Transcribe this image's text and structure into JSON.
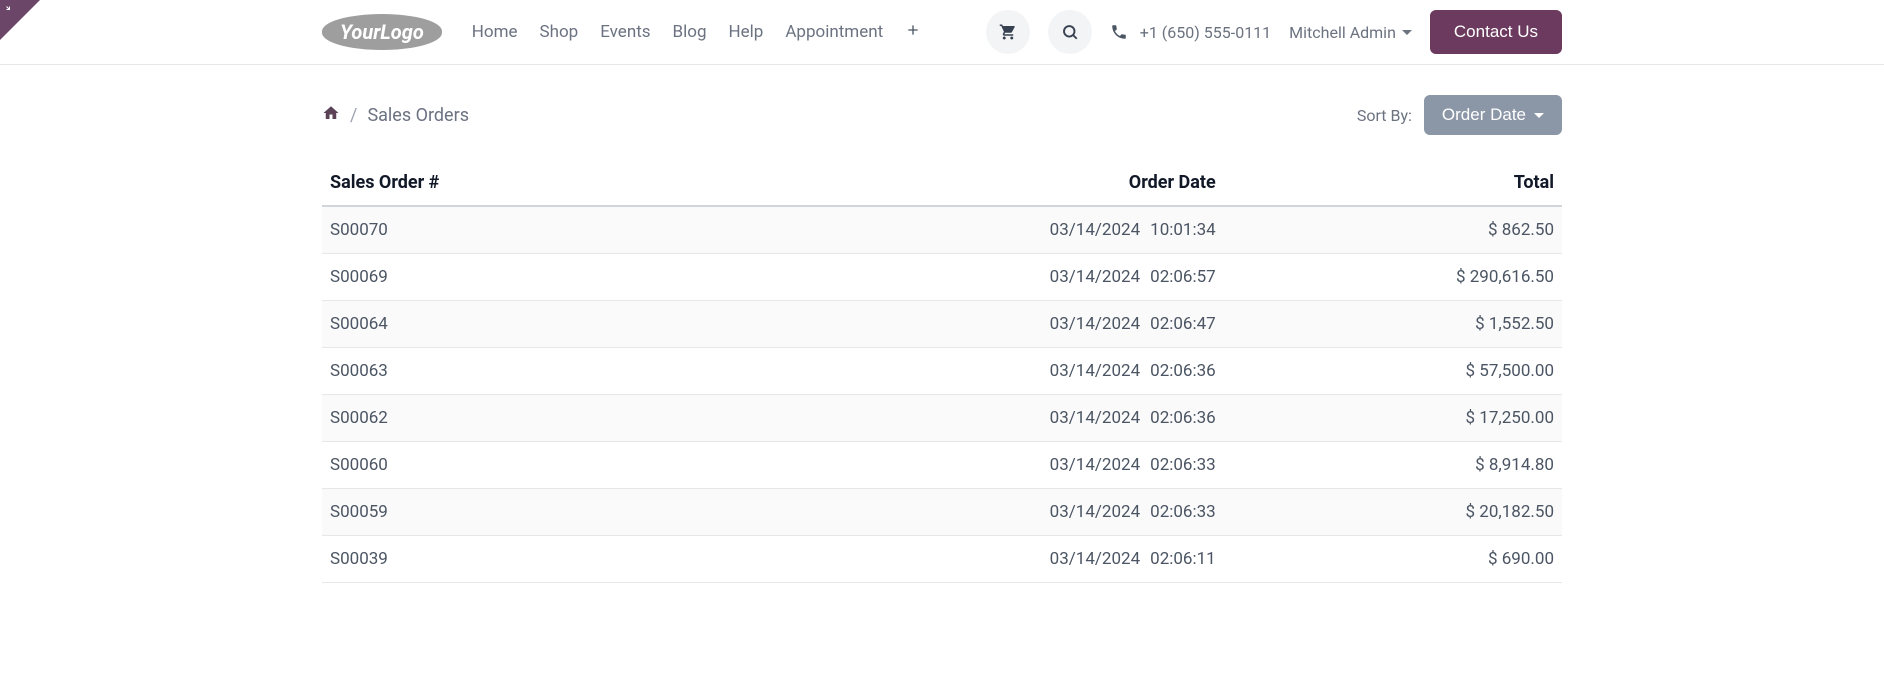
{
  "corner": "◢",
  "logo_text": "YourLogo",
  "nav": {
    "home": "Home",
    "shop": "Shop",
    "events": "Events",
    "blog": "Blog",
    "help": "Help",
    "appointment": "Appointment"
  },
  "header": {
    "phone": "+1 (650) 555-0111",
    "user": "Mitchell Admin",
    "contact_btn": "Contact Us"
  },
  "breadcrumb": {
    "page": "Sales Orders"
  },
  "sort": {
    "label": "Sort By:",
    "btn": "Order Date"
  },
  "table": {
    "headers": {
      "order_no": "Sales Order #",
      "date": "Order Date",
      "total": "Total"
    },
    "rows": [
      {
        "order": "S00070",
        "date": "03/14/2024",
        "time": "10:01:34",
        "total": "$ 862.50"
      },
      {
        "order": "S00069",
        "date": "03/14/2024",
        "time": "02:06:57",
        "total": "$ 290,616.50"
      },
      {
        "order": "S00064",
        "date": "03/14/2024",
        "time": "02:06:47",
        "total": "$ 1,552.50"
      },
      {
        "order": "S00063",
        "date": "03/14/2024",
        "time": "02:06:36",
        "total": "$ 57,500.00"
      },
      {
        "order": "S00062",
        "date": "03/14/2024",
        "time": "02:06:36",
        "total": "$ 17,250.00"
      },
      {
        "order": "S00060",
        "date": "03/14/2024",
        "time": "02:06:33",
        "total": "$ 8,914.80"
      },
      {
        "order": "S00059",
        "date": "03/14/2024",
        "time": "02:06:33",
        "total": "$ 20,182.50"
      },
      {
        "order": "S00039",
        "date": "03/14/2024",
        "time": "02:06:11",
        "total": "$ 690.00"
      }
    ]
  }
}
